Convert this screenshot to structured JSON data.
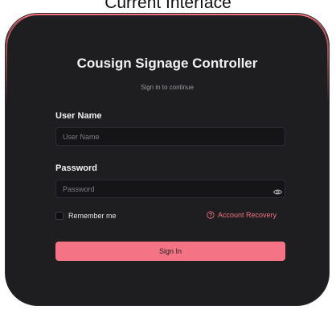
{
  "caption": "Current Interface",
  "login": {
    "title": "Cousign Signage Controller",
    "subtitle": "Sign in to continue",
    "username_label": "User Name",
    "username_placeholder": "User Name",
    "password_label": "Password",
    "password_placeholder": "Password",
    "remember_label": "Remember me",
    "recovery_label": "Account Recovery",
    "signin_label": "Sign In"
  },
  "icons": {
    "password_toggle": "eye-icon",
    "recovery": "question-circle-icon"
  },
  "colors": {
    "accent": "#f47384",
    "card_background": "#1e1e20",
    "input_background": "#151517"
  }
}
